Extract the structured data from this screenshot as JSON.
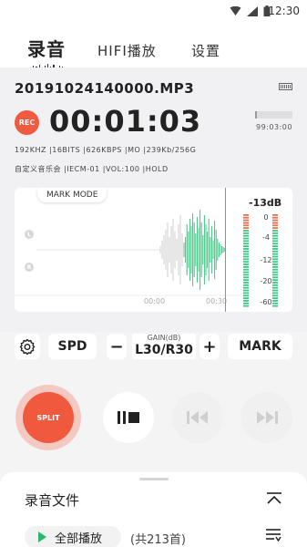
{
  "status_bar": {
    "time": "12:30"
  },
  "tabs": [
    {
      "label": "录音"
    },
    {
      "label": "HIFI播放"
    },
    {
      "label": "设置"
    }
  ],
  "recording": {
    "file_name": "20191024140000.MP3",
    "rec_badge": "REC",
    "timer": "00:01:03",
    "remaining_time": "99:03:00",
    "storage_used_fraction": 0.05
  },
  "specs": {
    "line1": "192KHZ  |16BITS  |626KBPS  |MO  |239Kb/256G",
    "line2": "自定义音乐会  |IECM-01  |VOL:100  |HOLD"
  },
  "waveform": {
    "mark_mode": "MARK MODE",
    "left_channel": "L",
    "right_channel": "R",
    "time_ticks": [
      "00:00",
      "00:30"
    ],
    "db_readout": "-13dB",
    "meter_scale": [
      "0",
      "-4",
      "-12",
      "-20",
      "-60"
    ],
    "accent_green": "#3cc784",
    "accent_red": "#e8704f"
  },
  "controls": {
    "spd_label": "SPD",
    "minus_label": "−",
    "gain_title": "GAIN(dB)",
    "gain_value": "L30/R30",
    "plus_label": "+",
    "mark_label": "MARK"
  },
  "transport": {
    "split_label": "SPLIT"
  },
  "files_sheet": {
    "title": "录音文件",
    "play_all": "全部播放",
    "count": "(共213首)"
  }
}
